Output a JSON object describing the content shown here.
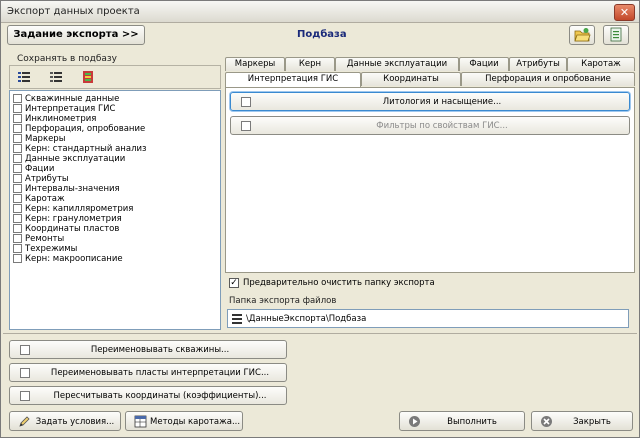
{
  "window": {
    "title": "Экспорт данных проекта"
  },
  "header": {
    "task_button": "Задание экспорта  >>",
    "section_title": "Подбаза"
  },
  "left_panel": {
    "label": "Сохранять в подбазу",
    "items": [
      "Скважинные данные",
      "Интерпретация ГИС",
      "Инклинометрия",
      "Перфорация, опробование",
      "Маркеры",
      "Керн: стандартный анализ",
      "Данные эксплуатации",
      "Фации",
      "Атрибуты",
      "Интервалы-значения",
      "Каротаж",
      "Керн: капиллярометрия",
      "Керн: гранулометрия",
      "Координаты пластов",
      "Ремонты",
      "Техрежимы",
      "Керн: макроописание"
    ]
  },
  "tabs": {
    "row_back": [
      "Маркеры",
      "Керн",
      "Данные эксплуатации",
      "Фации",
      "Атрибуты",
      "Каротаж"
    ],
    "row_front": [
      "Интерпретация ГИС",
      "Координаты",
      "Перфорация и опробование"
    ],
    "active": "Интерпретация ГИС"
  },
  "tab_content": {
    "lithology_button": "Литология и насыщение...",
    "filters_button": "Фильтры по свойствам ГИС..."
  },
  "options": {
    "clear_folder_label": "Предварительно очистить папку экспорта",
    "clear_folder_checked": true,
    "folder_label": "Папка экспорта файлов",
    "folder_value": "\\ДанныеЭкспорта\\Подбаза"
  },
  "actions": {
    "rename_wells": "Переименовывать скважины...",
    "rename_layers": "Переименовывать пласты интерпретации ГИС...",
    "recalc_coords": "Пересчитывать координаты (коэффициенты)...",
    "set_conditions": "Задать условия...",
    "logging_methods": "Методы каротажа...",
    "run": "Выполнить",
    "close": "Закрыть"
  },
  "colors": {
    "accent_title": "#1a2a7a",
    "focus_border": "#3a8ad0"
  }
}
